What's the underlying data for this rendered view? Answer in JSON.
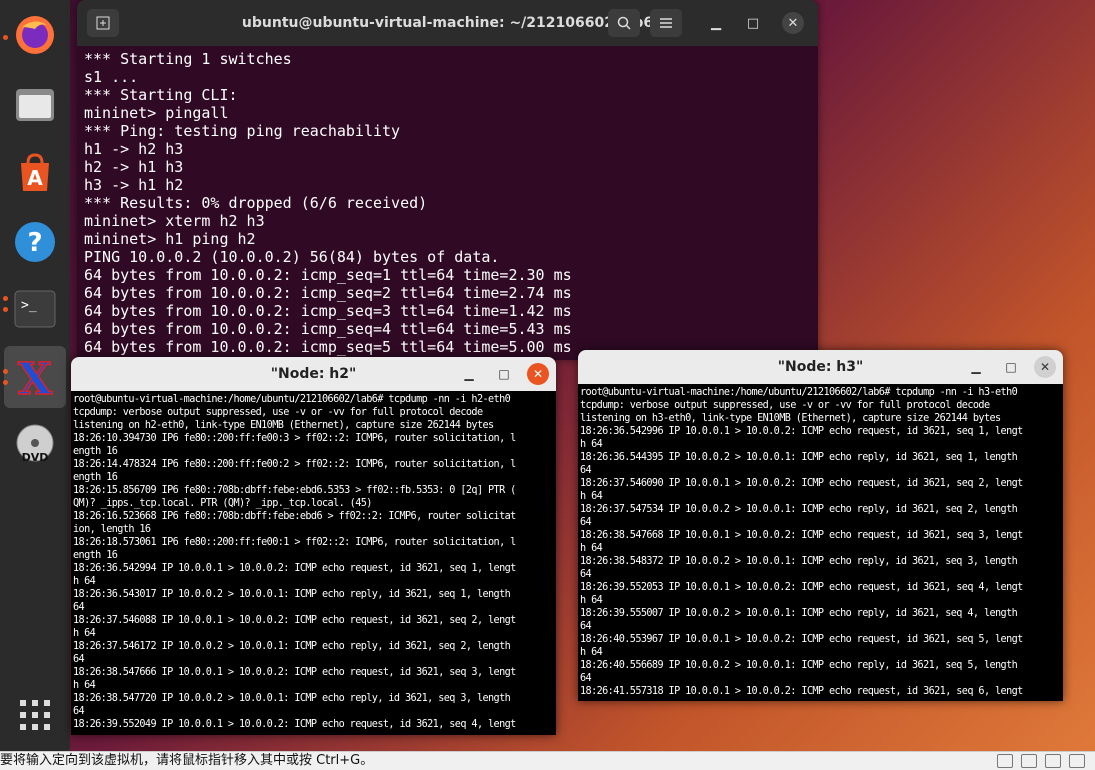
{
  "dock": {
    "items": [
      {
        "name": "firefox-icon"
      },
      {
        "name": "files-icon"
      },
      {
        "name": "software-center-icon"
      },
      {
        "name": "help-icon"
      },
      {
        "name": "terminal-icon",
        "glyph": ">_"
      },
      {
        "name": "xterm-icon",
        "glyph": "X"
      },
      {
        "name": "dvd-icon",
        "glyph": "DVD"
      },
      {
        "name": "apps-grid-icon"
      }
    ]
  },
  "main_terminal": {
    "title": "ubuntu@ubuntu-virtual-machine: ~/212106602/lab6",
    "lines": [
      "*** Starting 1 switches",
      "s1 ...",
      "*** Starting CLI:",
      "mininet> pingall",
      "*** Ping: testing ping reachability",
      "h1 -> h2 h3",
      "h2 -> h1 h3",
      "h3 -> h1 h2",
      "*** Results: 0% dropped (6/6 received)",
      "mininet> xterm h2 h3",
      "mininet> h1 ping h2",
      "PING 10.0.0.2 (10.0.0.2) 56(84) bytes of data.",
      "64 bytes from 10.0.0.2: icmp_seq=1 ttl=64 time=2.30 ms",
      "64 bytes from 10.0.0.2: icmp_seq=2 ttl=64 time=2.74 ms",
      "64 bytes from 10.0.0.2: icmp_seq=3 ttl=64 time=1.42 ms",
      "64 bytes from 10.0.0.2: icmp_seq=4 ttl=64 time=5.43 ms",
      "64 bytes from 10.0.0.2: icmp_seq=5 ttl=64 time=5.00 ms"
    ]
  },
  "node_h2": {
    "title": "\"Node: h2\"",
    "lines": [
      "root@ubuntu-virtual-machine:/home/ubuntu/212106602/lab6# tcpdump -nn -i h2-eth0",
      "tcpdump: verbose output suppressed, use -v or -vv for full protocol decode",
      "listening on h2-eth0, link-type EN10MB (Ethernet), capture size 262144 bytes",
      "18:26:10.394730 IP6 fe80::200:ff:fe00:3 > ff02::2: ICMP6, router solicitation, l",
      "ength 16",
      "18:26:14.478324 IP6 fe80::200:ff:fe00:2 > ff02::2: ICMP6, router solicitation, l",
      "ength 16",
      "18:26:15.856709 IP6 fe80::708b:dbff:febe:ebd6.5353 > ff02::fb.5353: 0 [2q] PTR (",
      "QM)? _ipps._tcp.local. PTR (QM)? _ipp._tcp.local. (45)",
      "18:26:16.523668 IP6 fe80::708b:dbff:febe:ebd6 > ff02::2: ICMP6, router solicitat",
      "ion, length 16",
      "18:26:18.573061 IP6 fe80::200:ff:fe00:1 > ff02::2: ICMP6, router solicitation, l",
      "ength 16",
      "18:26:36.542994 IP 10.0.0.1 > 10.0.0.2: ICMP echo request, id 3621, seq 1, lengt",
      "h 64",
      "18:26:36.543017 IP 10.0.0.2 > 10.0.0.1: ICMP echo reply, id 3621, seq 1, length",
      "64",
      "18:26:37.546088 IP 10.0.0.1 > 10.0.0.2: ICMP echo request, id 3621, seq 2, lengt",
      "h 64",
      "18:26:37.546172 IP 10.0.0.2 > 10.0.0.1: ICMP echo reply, id 3621, seq 2, length",
      "64",
      "18:26:38.547666 IP 10.0.0.1 > 10.0.0.2: ICMP echo request, id 3621, seq 3, lengt",
      "h 64",
      "18:26:38.547720 IP 10.0.0.2 > 10.0.0.1: ICMP echo reply, id 3621, seq 3, length",
      "64",
      "18:26:39.552049 IP 10.0.0.1 > 10.0.0.2: ICMP echo request, id 3621, seq 4, lengt"
    ]
  },
  "node_h3": {
    "title": "\"Node: h3\"",
    "lines": [
      "root@ubuntu-virtual-machine:/home/ubuntu/212106602/lab6# tcpdump -nn -i h3-eth0",
      "tcpdump: verbose output suppressed, use -v or -vv for full protocol decode",
      "listening on h3-eth0, link-type EN10MB (Ethernet), capture size 262144 bytes",
      "18:26:36.542996 IP 10.0.0.1 > 10.0.0.2: ICMP echo request, id 3621, seq 1, lengt",
      "h 64",
      "18:26:36.544395 IP 10.0.0.2 > 10.0.0.1: ICMP echo reply, id 3621, seq 1, length",
      "64",
      "18:26:37.546090 IP 10.0.0.1 > 10.0.0.2: ICMP echo request, id 3621, seq 2, lengt",
      "h 64",
      "18:26:37.547534 IP 10.0.0.2 > 10.0.0.1: ICMP echo reply, id 3621, seq 2, length",
      "64",
      "18:26:38.547668 IP 10.0.0.1 > 10.0.0.2: ICMP echo request, id 3621, seq 3, lengt",
      "h 64",
      "18:26:38.548372 IP 10.0.0.2 > 10.0.0.1: ICMP echo reply, id 3621, seq 3, length",
      "64",
      "18:26:39.552053 IP 10.0.0.1 > 10.0.0.2: ICMP echo request, id 3621, seq 4, lengt",
      "h 64",
      "18:26:39.555007 IP 10.0.0.2 > 10.0.0.1: ICMP echo reply, id 3621, seq 4, length",
      "64",
      "18:26:40.553967 IP 10.0.0.1 > 10.0.0.2: ICMP echo request, id 3621, seq 5, lengt",
      "h 64",
      "18:26:40.556689 IP 10.0.0.2 > 10.0.0.1: ICMP echo reply, id 3621, seq 5, length",
      "64",
      "18:26:41.557318 IP 10.0.0.1 > 10.0.0.2: ICMP echo request, id 3621, seq 6, lengt"
    ]
  },
  "statusbar": {
    "text": "要将输入定向到该虚拟机，请将鼠标指针移入其中或按 Ctrl+G。"
  },
  "colors": {
    "terminal_bg": "#300a24",
    "dock_bg": "#2b2b2b",
    "accent": "#e95420"
  }
}
